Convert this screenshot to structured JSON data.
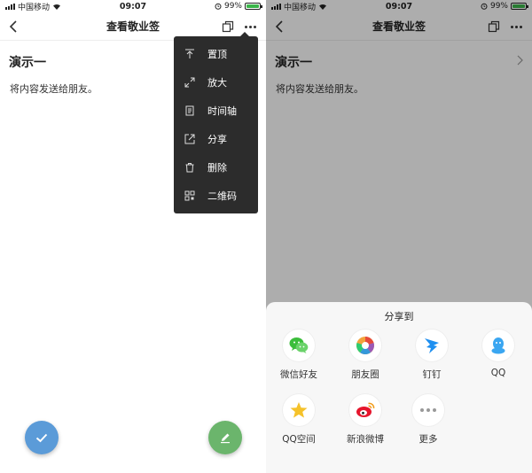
{
  "status": {
    "carrier": "中国移动",
    "time": "09:07",
    "battery": "99%",
    "battery_level": 0.99
  },
  "nav": {
    "title": "查看敬业签"
  },
  "note": {
    "title": "演示一",
    "body": "将内容发送给朋友。"
  },
  "menu": {
    "items": [
      {
        "label": "置顶",
        "icon": "pin-top-icon"
      },
      {
        "label": "放大",
        "icon": "expand-icon"
      },
      {
        "label": "时间轴",
        "icon": "timeline-icon"
      },
      {
        "label": "分享",
        "icon": "share-icon"
      },
      {
        "label": "删除",
        "icon": "trash-icon"
      },
      {
        "label": "二维码",
        "icon": "qrcode-icon"
      }
    ]
  },
  "share_sheet": {
    "title": "分享到",
    "items": [
      {
        "label": "微信好友",
        "icon": "wechat-icon"
      },
      {
        "label": "朋友圈",
        "icon": "moments-icon"
      },
      {
        "label": "钉钉",
        "icon": "dingtalk-icon"
      },
      {
        "label": "QQ",
        "icon": "qq-icon"
      },
      {
        "label": "QQ空间",
        "icon": "qzone-icon"
      },
      {
        "label": "新浪微博",
        "icon": "weibo-icon"
      },
      {
        "label": "更多",
        "icon": "more-icon"
      }
    ]
  },
  "colors": {
    "check_fab": "#5b9bd8",
    "edit_fab": "#6bb56c",
    "menu_bg": "#2c2c2c",
    "wechat": "#3bbd3b",
    "dingtalk": "#1e8ff0",
    "qq": "#3aa6f1",
    "qzone": "#f5c22a",
    "weibo": "#e6162d"
  }
}
